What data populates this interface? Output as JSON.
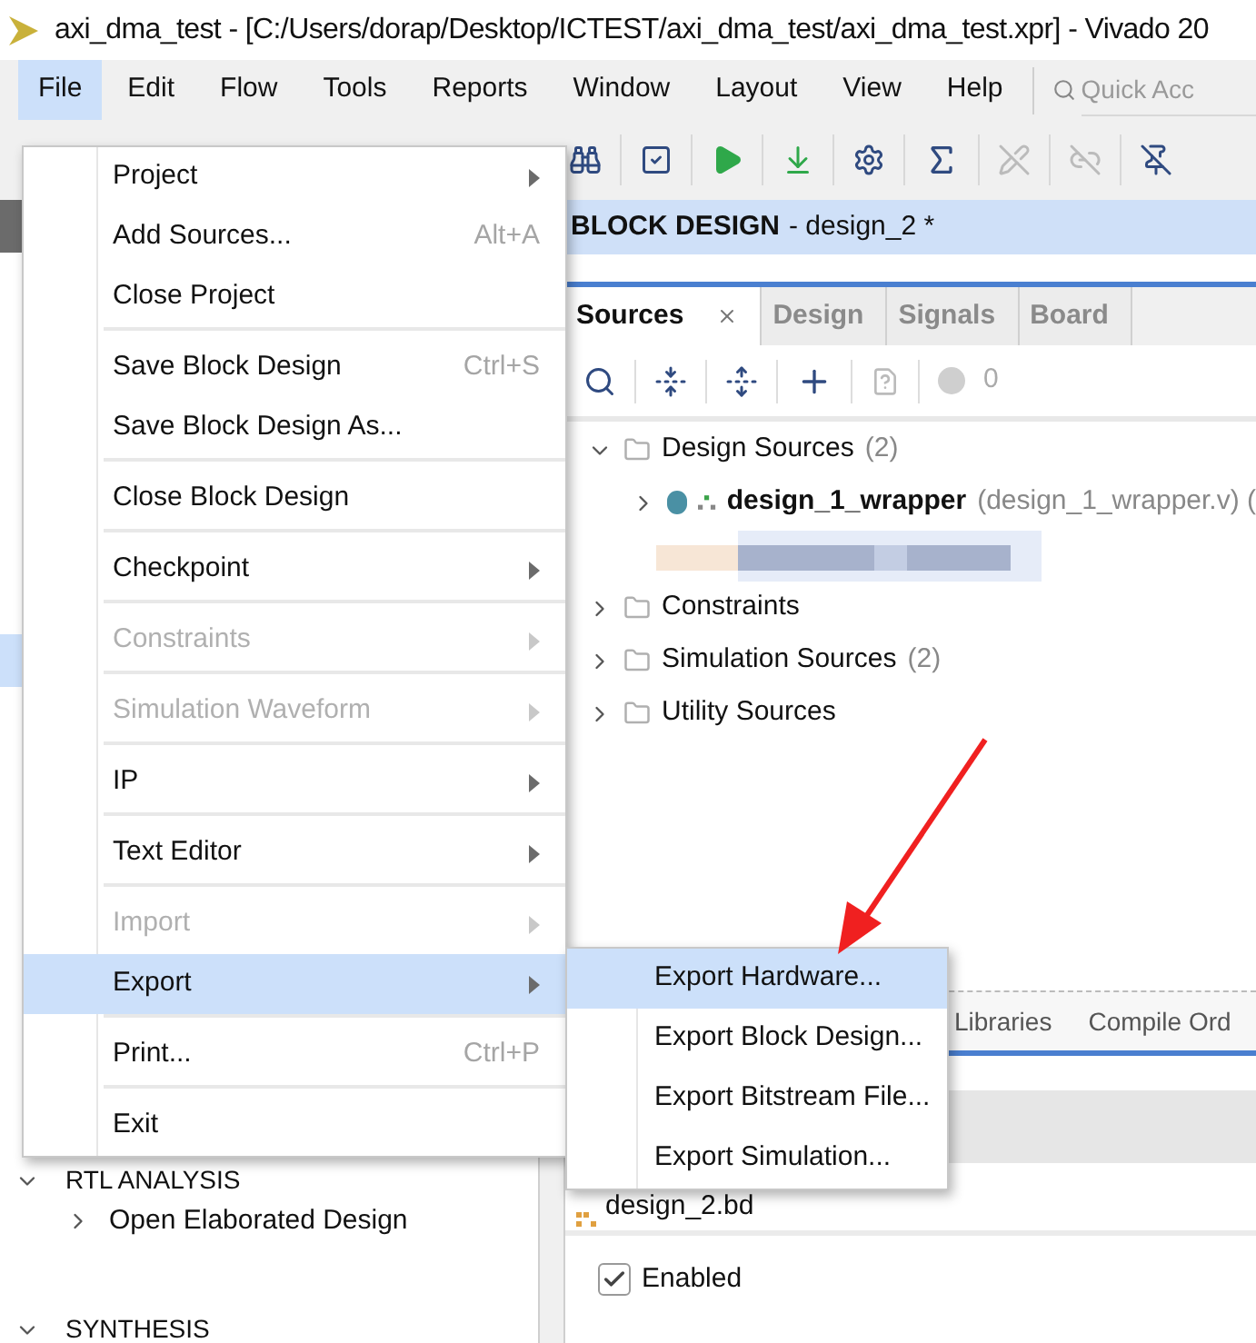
{
  "title_bar": {
    "text": "axi_dma_test - [C:/Users/dorap/Desktop/ICTEST/axi_dma_test/axi_dma_test.xpr] - Vivado 20"
  },
  "menu_bar": [
    {
      "label": "File",
      "selected": true
    },
    {
      "label": "Edit",
      "selected": false
    },
    {
      "label": "Flow",
      "selected": false
    },
    {
      "label": "Tools",
      "selected": false
    },
    {
      "label": "Reports",
      "selected": false
    },
    {
      "label": "Window",
      "selected": false
    },
    {
      "label": "Layout",
      "selected": false
    },
    {
      "label": "View",
      "selected": false
    },
    {
      "label": "Help",
      "selected": false
    }
  ],
  "quick_access": {
    "placeholder": "Quick Acc"
  },
  "flow_navigator": {
    "sections": [
      {
        "label": "RTL ANALYSIS",
        "expanded": true,
        "children": [
          {
            "label": "Open Elaborated Design",
            "expanded": false
          }
        ]
      },
      {
        "label": "SYNTHESIS",
        "expanded": true
      }
    ]
  },
  "block_design_header": {
    "title": "BLOCK DESIGN",
    "subtitle": "- design_2 *"
  },
  "sources_panel": {
    "tabs": [
      {
        "label": "Sources",
        "selected": true
      },
      {
        "label": "Design",
        "selected": false
      },
      {
        "label": "Signals",
        "selected": false
      },
      {
        "label": "Board",
        "selected": false
      }
    ],
    "message_count": "0",
    "tree": [
      {
        "kind": "folder",
        "label": "Design Sources",
        "count": "(2)",
        "expanded": true,
        "children": [
          {
            "kind": "module",
            "label": "design_1_wrapper",
            "detail": "(design_1_wrapper.v) (",
            "expanded": false
          },
          {
            "kind": "redacted"
          }
        ]
      },
      {
        "kind": "folder",
        "label": "Constraints",
        "expanded": false
      },
      {
        "kind": "folder",
        "label": "Simulation Sources",
        "count": "(2)",
        "expanded": false
      },
      {
        "kind": "folder",
        "label": "Utility Sources",
        "expanded": false
      }
    ]
  },
  "bottom_panel": {
    "tabs": [
      "Libraries",
      "Compile Ord"
    ],
    "file": "design_2.bd",
    "enabled": {
      "label": "Enabled",
      "checked": true
    }
  },
  "file_menu": {
    "groups": [
      [
        {
          "label": "Project",
          "submenu": true,
          "disabled": false,
          "selected": false
        },
        {
          "label": "Add Sources...",
          "shortcut": "Alt+A",
          "disabled": false,
          "selected": false
        },
        {
          "label": "Close Project",
          "disabled": false,
          "selected": false
        }
      ],
      [
        {
          "label": "Save Block Design",
          "shortcut": "Ctrl+S",
          "disabled": false,
          "selected": false
        },
        {
          "label": "Save Block Design As...",
          "disabled": false,
          "selected": false
        }
      ],
      [
        {
          "label": "Close Block Design",
          "disabled": false,
          "selected": false
        }
      ],
      [
        {
          "label": "Checkpoint",
          "submenu": true,
          "disabled": false,
          "selected": false
        }
      ],
      [
        {
          "label": "Constraints",
          "submenu": true,
          "disabled": true,
          "selected": false
        }
      ],
      [
        {
          "label": "Simulation Waveform",
          "submenu": true,
          "disabled": true,
          "selected": false
        }
      ],
      [
        {
          "label": "IP",
          "submenu": true,
          "disabled": false,
          "selected": false
        }
      ],
      [
        {
          "label": "Text Editor",
          "submenu": true,
          "disabled": false,
          "selected": false
        }
      ],
      [
        {
          "label": "Import",
          "submenu": true,
          "disabled": true,
          "selected": false
        },
        {
          "label": "Export",
          "submenu": true,
          "disabled": false,
          "selected": true
        }
      ],
      [
        {
          "label": "Print...",
          "shortcut": "Ctrl+P",
          "disabled": false,
          "selected": false
        }
      ],
      [
        {
          "label": "Exit",
          "disabled": false,
          "selected": false
        }
      ]
    ]
  },
  "export_submenu": [
    {
      "label": "Export Hardware...",
      "selected": true
    },
    {
      "label": "Export Block Design...",
      "selected": false
    },
    {
      "label": "Export Bitstream File...",
      "selected": false
    },
    {
      "label": "Export Simulation...",
      "selected": false
    }
  ]
}
